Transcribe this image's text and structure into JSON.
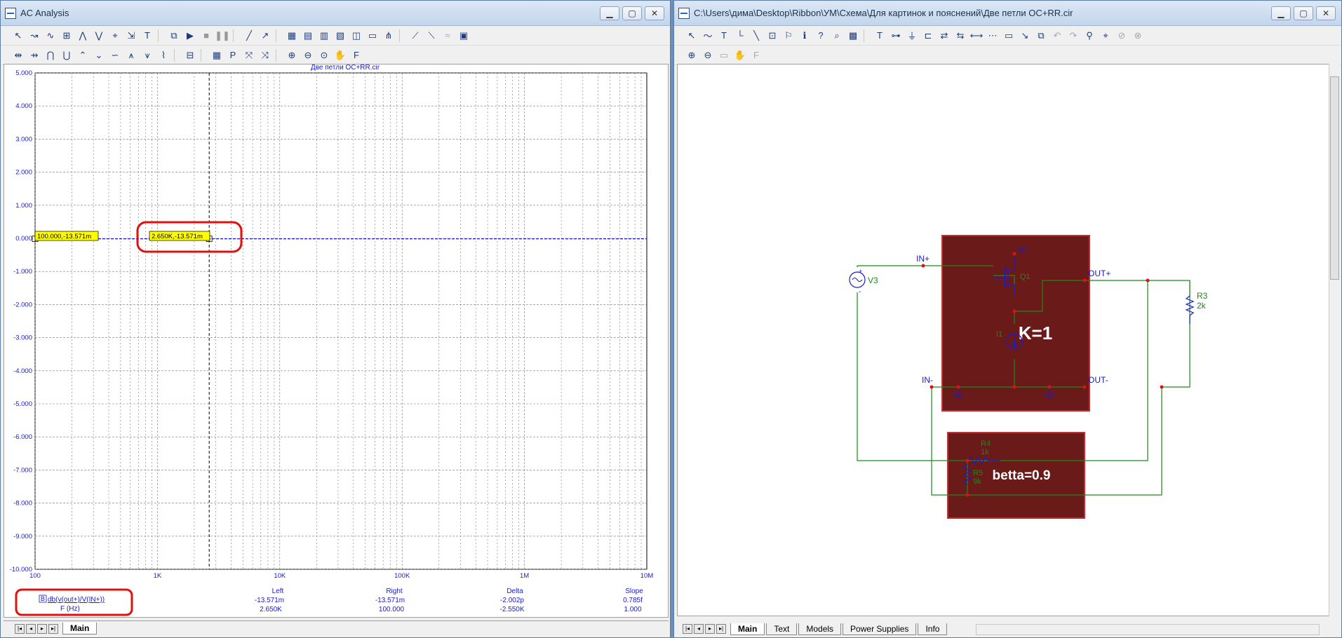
{
  "left_window": {
    "title": "AC Analysis",
    "plot_title": "Две петли ОС+RR.cir",
    "y_ticks": [
      "5.000",
      "4.000",
      "3.000",
      "2.000",
      "1.000",
      "0.000",
      "-1.000",
      "-2.000",
      "-3.000",
      "-4.000",
      "-5.000",
      "-6.000",
      "-7.000",
      "-8.000",
      "-9.000",
      "-10.000"
    ],
    "x_ticks": [
      "100",
      "1K",
      "10K",
      "100K",
      "1M",
      "10M"
    ],
    "cursor1_label": "100.000,-13.571m",
    "cursor2_label": "2.650K,-13.571m",
    "trace_expr": "db(v(out+)/V(IN+))",
    "trace_badge": "B",
    "x_axis_name": "F (Hz)",
    "readout": {
      "left_header": "Left",
      "left_y": "-13.571m",
      "left_x": "2.650K",
      "right_header": "Right",
      "right_y": "-13.571m",
      "right_x": "100.000",
      "delta_header": "Delta",
      "delta_y": "-2.002p",
      "delta_x": "-2.550K",
      "slope_header": "Slope",
      "slope_y": "0.785f",
      "slope_x": "1.000"
    },
    "tab_main": "Main",
    "colors": {
      "trace": "#1a1acc",
      "axis_text": "#1a1acc",
      "highlight": "#e01010",
      "cursor_box": "#ffff00"
    }
  },
  "chart_data": {
    "type": "line",
    "title": "Две петли ОС+RR.cir",
    "xlabel": "F (Hz)",
    "ylabel": "",
    "x_scale": "log",
    "xlim": [
      100,
      10000000
    ],
    "ylim": [
      -10,
      5
    ],
    "series": [
      {
        "name": "db(v(out+)/V(IN+))",
        "x": [
          100,
          1000,
          10000,
          100000,
          1000000,
          10000000
        ],
        "y": [
          -0.013571,
          -0.013571,
          -0.013571,
          -0.013571,
          -0.013571,
          -0.013571
        ]
      }
    ],
    "cursors": [
      {
        "x": 100,
        "y": -0.013571
      },
      {
        "x": 2650,
        "y": -0.013571
      }
    ],
    "grid": true
  },
  "right_window": {
    "title": "C:\\Users\\дима\\Desktop\\Ribbon\\УМ\\Схема\\Для картинок и пояснений\\Две петли ОС+RR.cir",
    "tabs": [
      "Main",
      "Text",
      "Models",
      "Power Supplies",
      "Info"
    ],
    "schematic": {
      "block1_label": "K=1",
      "block2_label": "betta=0.9",
      "v3": "V3",
      "in_plus": "IN+",
      "in_minus": "IN-",
      "out_plus": "OUT+",
      "out_minus": "OUT-",
      "vc": "VC",
      "q1": "Q1",
      "i1": "I1",
      "r3_name": "R3",
      "r3_val": "2k",
      "r4_name": "R4",
      "r4_val": "1k",
      "r5_name": "R5",
      "r5_val": "9k",
      "plus_sign": "+",
      "minus_sign": "-",
      "colors": {
        "block": "#6b1a1a",
        "wire": "#1a8a1a",
        "node": "#e01010",
        "label": "#1a1acc",
        "comp_label": "#1a8a1a"
      }
    }
  }
}
